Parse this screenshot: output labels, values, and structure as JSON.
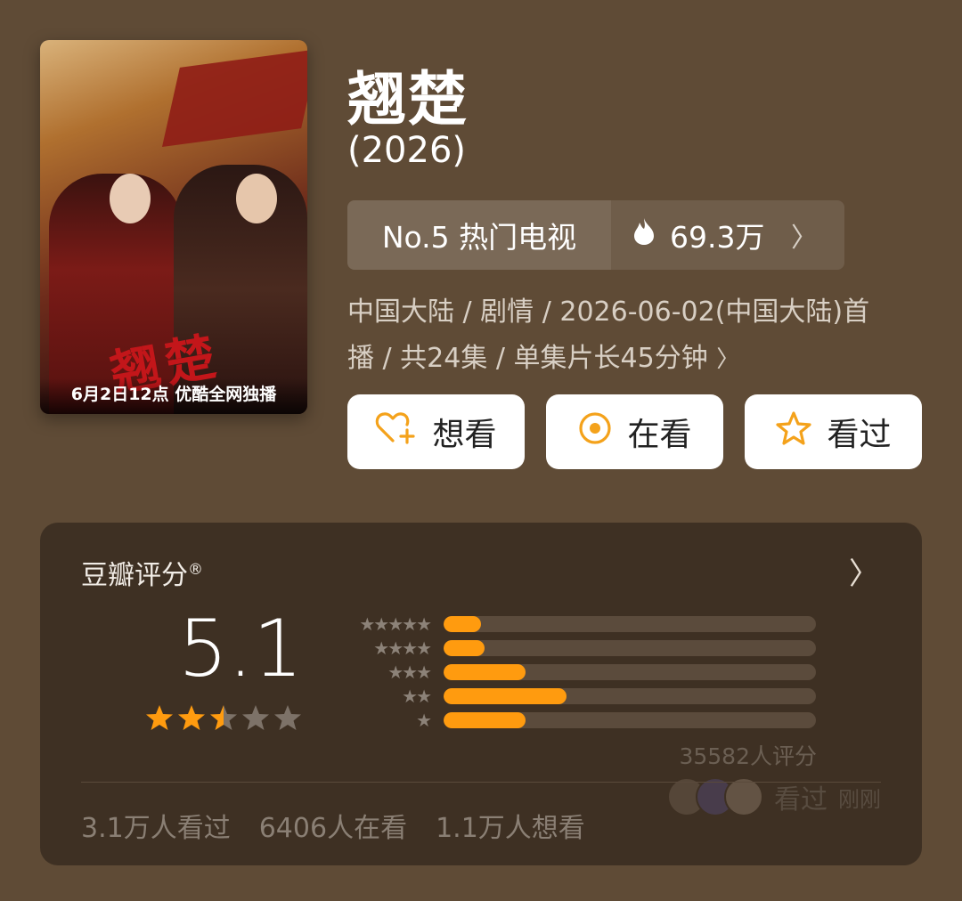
{
  "poster": {
    "caption": "6月2日12点  优酷全网独播",
    "calligraphy": "翘楚"
  },
  "title": "翘楚",
  "year": "(2026)",
  "rank": {
    "label": "No.5 热门电视",
    "heat": "69.3万"
  },
  "meta": {
    "line1": "中国大陆 / 剧情 / 2026-06-02(中国大陆)首",
    "line2": "播 / 共24集 / 单集片长45分钟"
  },
  "actions": [
    {
      "label": "想看",
      "icon": "heart-plus-icon"
    },
    {
      "label": "在看",
      "icon": "target-icon"
    },
    {
      "label": "看过",
      "icon": "star-outline-icon"
    }
  ],
  "rating": {
    "heading": "豆瓣评分",
    "reg": "®",
    "score": "5.1",
    "star_value": 2.5,
    "distribution": [
      {
        "stars": 5,
        "fraction": 0.1
      },
      {
        "stars": 4,
        "fraction": 0.11
      },
      {
        "stars": 3,
        "fraction": 0.22
      },
      {
        "stars": 2,
        "fraction": 0.33
      },
      {
        "stars": 1,
        "fraction": 0.22
      }
    ],
    "count": "35582人评分",
    "watched": "3.1万人看过",
    "watching": "6406人在看",
    "want": "1.1万人想看",
    "recent_label": "看过",
    "recent_time": "刚刚"
  },
  "colors": {
    "accent": "#ff9b0f",
    "background": "#5f4b36",
    "card": "#3e3023"
  }
}
